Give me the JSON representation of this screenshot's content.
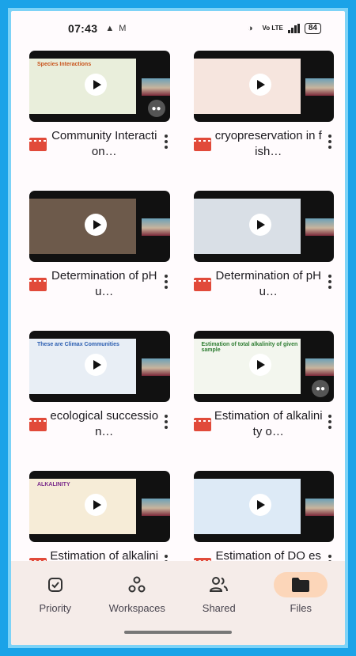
{
  "status_bar": {
    "time": "07:43",
    "battery": "84",
    "network": "Vo LTE"
  },
  "files": [
    {
      "title": "Community Interaction…",
      "thumb_text": "Species Interactions",
      "slide_color": "#e9eedb",
      "title_color": "#c8531b",
      "shared": true
    },
    {
      "title": "cryopreservation in fish…",
      "thumb_text": "",
      "slide_color": "#f6e5de",
      "title_color": "#b23b2b",
      "shared": false
    },
    {
      "title": "Determination of pH u…",
      "thumb_text": "",
      "slide_color": "#6d5a4b",
      "title_color": "#ffffff",
      "shared": false
    },
    {
      "title": "Determination of pH u…",
      "thumb_text": "",
      "slide_color": "#d9dfe6",
      "title_color": "#333333",
      "shared": false
    },
    {
      "title": "ecological succession…",
      "thumb_text": "These are Climax Communities",
      "slide_color": "#e8eef5",
      "title_color": "#2a5db0",
      "shared": false
    },
    {
      "title": "Estimation of alkalinity o…",
      "thumb_text": "Estimation of total alkalinity of given sample",
      "slide_color": "#f3f6ee",
      "title_color": "#2e7d32",
      "shared": true
    },
    {
      "title": "Estimation of alkalinity…",
      "thumb_text": "ALKALINITY",
      "slide_color": "#f6ecd7",
      "title_color": "#7a2b8a",
      "shared": false
    },
    {
      "title": "Estimation of DO est…",
      "thumb_text": "",
      "slide_color": "#ddeaf6",
      "title_color": "#1f4f8a",
      "shared": false
    }
  ],
  "nav": [
    {
      "label": "Priority",
      "icon": "priority-icon",
      "active": false
    },
    {
      "label": "Workspaces",
      "icon": "workspaces-icon",
      "active": false
    },
    {
      "label": "Shared",
      "icon": "shared-icon",
      "active": false
    },
    {
      "label": "Files",
      "icon": "folder-icon",
      "active": true
    }
  ]
}
